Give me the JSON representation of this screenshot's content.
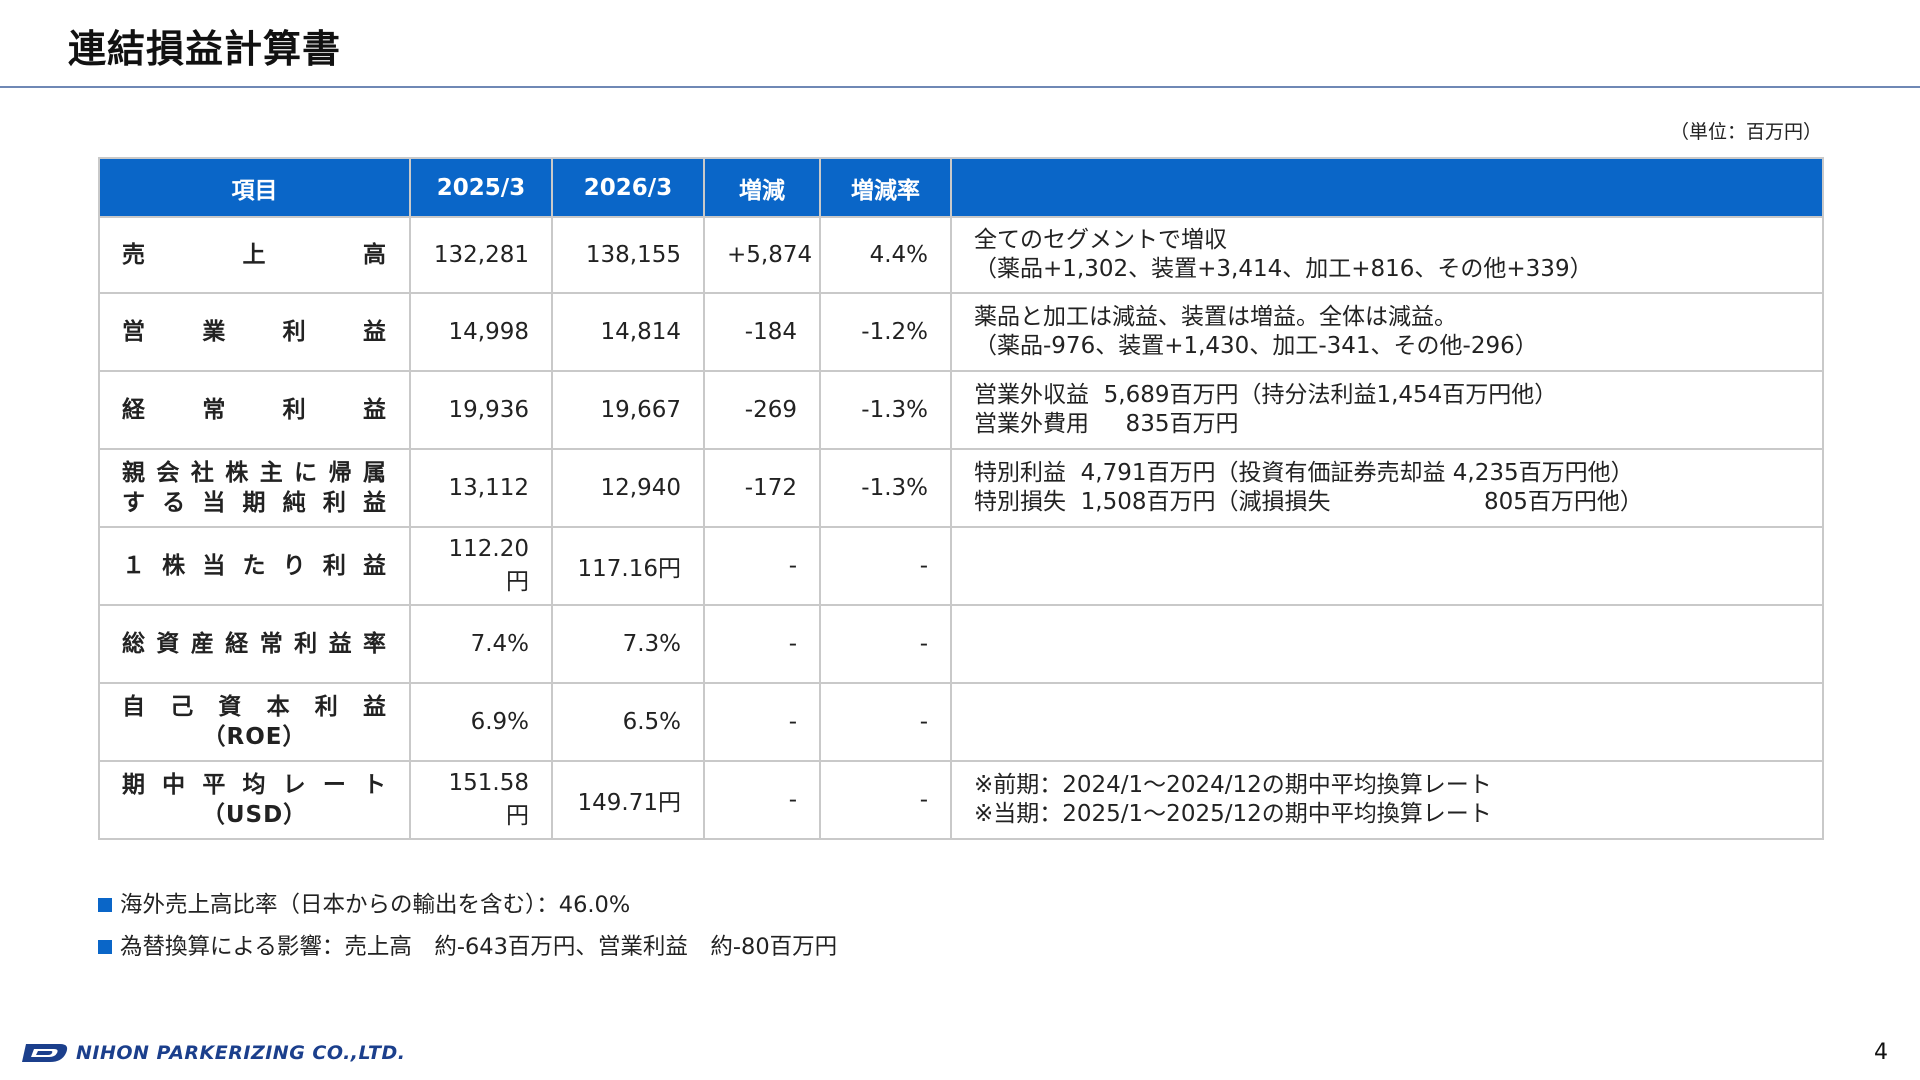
{
  "title": "連結損益計算書",
  "unit": "（単位：百万円）",
  "table": {
    "headers": [
      "項目",
      "2025/3",
      "2026/3",
      "増減",
      "増減率",
      ""
    ],
    "rows": [
      {
        "item_lines": [
          "売　　上　　高"
        ],
        "prev": "132,281",
        "curr": "138,155",
        "diff": "+5,874",
        "rate": "4.4%",
        "note": "全てのセグメントで増収\n（薬品+1,302、装置+3,414、加工+816、その他+339）"
      },
      {
        "item_lines": [
          "営　業　利　益"
        ],
        "prev": "14,998",
        "curr": "14,814",
        "diff": "-184",
        "rate": "-1.2%",
        "note": "薬品と加工は減益、装置は増益。全体は減益。\n（薬品-976、装置+1,430、加工-341、その他-296）"
      },
      {
        "item_lines": [
          "経　常　利　益"
        ],
        "prev": "19,936",
        "curr": "19,667",
        "diff": "-269",
        "rate": "-1.3%",
        "note": "営業外収益  5,689百万円（持分法利益1,454百万円他）\n営業外費用     835百万円"
      },
      {
        "item_lines": [
          "親会社株主に帰属",
          "する当期純利益"
        ],
        "prev": "13,112",
        "curr": "12,940",
        "diff": "-172",
        "rate": "-1.3%",
        "note": "特別利益  4,791百万円（投資有価証券売却益 4,235百万円他）\n特別損失  1,508百万円（減損損失                     805百万円他）"
      },
      {
        "item_lines": [
          "１株当たり利益"
        ],
        "prev": "112.20円",
        "curr": "117.16円",
        "diff": "-",
        "rate": "-",
        "note": ""
      },
      {
        "item_lines": [
          "総資産経常利益率"
        ],
        "prev": "7.4%",
        "curr": "7.3%",
        "diff": "-",
        "rate": "-",
        "note": ""
      },
      {
        "item_lines": [
          "自己資本利益",
          "（ROE）"
        ],
        "prev": "6.9%",
        "curr": "6.5%",
        "diff": "-",
        "rate": "-",
        "note": ""
      },
      {
        "item_lines": [
          "期中平均レート",
          "（USD）"
        ],
        "prev": "151.58円",
        "curr": "149.71円",
        "diff": "-",
        "rate": "-",
        "note": "※前期：2024/1～2024/12の期中平均換算レート\n※当期：2025/1～2025/12の期中平均換算レート"
      }
    ]
  },
  "footnotes": [
    "海外売上高比率（日本からの輸出を含む）：46.0%",
    "為替換算による影響：売上高　約-643百万円、営業利益　約-80百万円"
  ],
  "company_logo_text": "NIHON PARKERIZING CO.,LTD.",
  "page_number": "4",
  "colors": {
    "header_bg": "#0a66c8",
    "bullet": "#0a66c8",
    "rule": "#6f88b5",
    "logo": "#1b3f8c"
  }
}
